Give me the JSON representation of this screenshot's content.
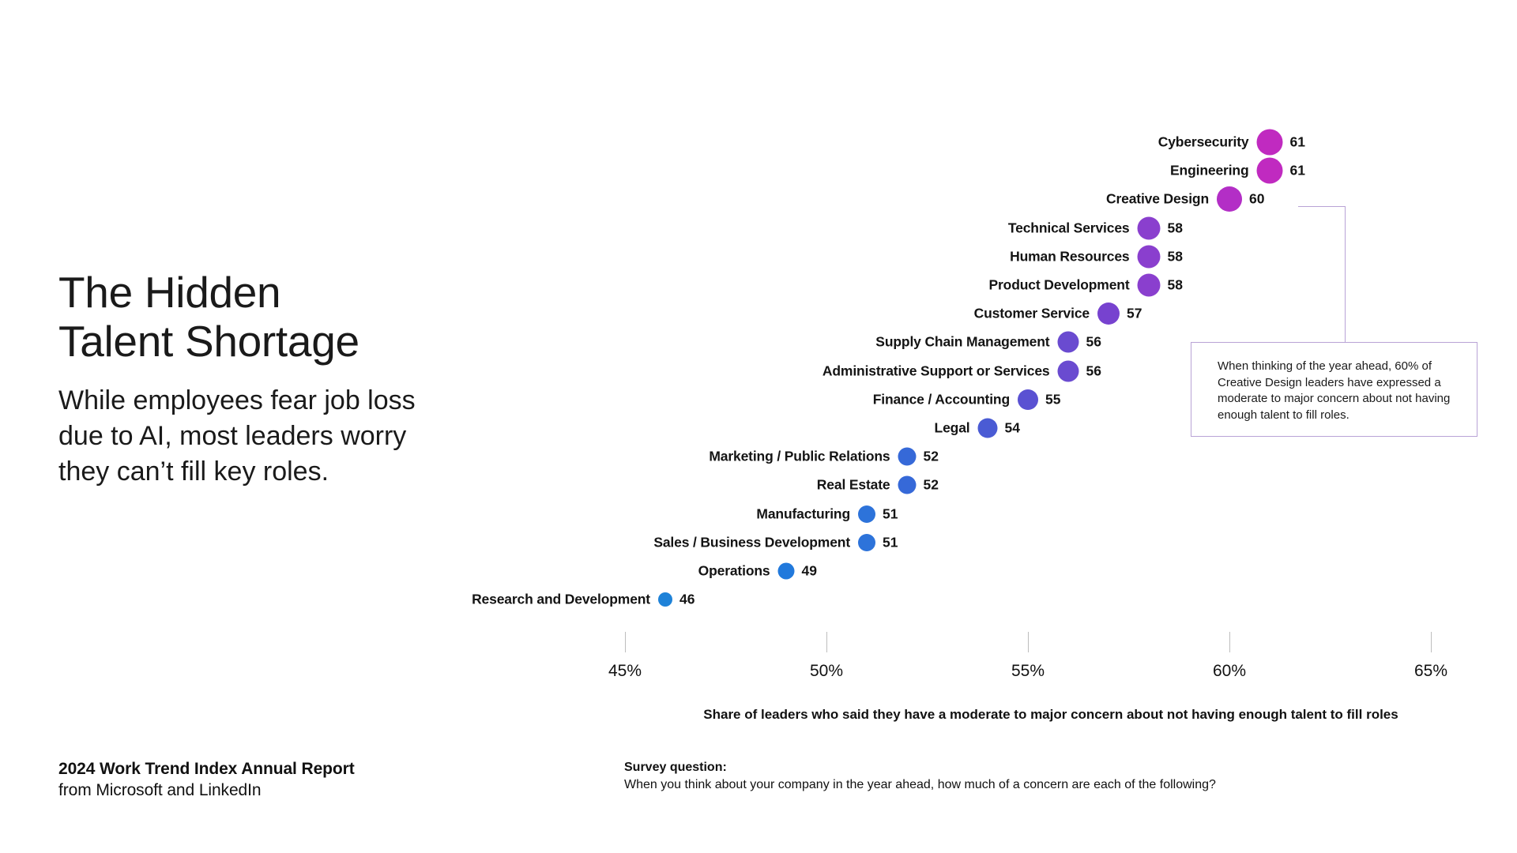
{
  "headline": "The Hidden\nTalent Shortage",
  "subhead": "While employees fear job loss\ndue to AI, most leaders worry\nthey can’t fill key roles.",
  "footer": {
    "report_title": "2024 Work Trend Index Annual Report",
    "report_source": "from Microsoft and LinkedIn",
    "survey_label": "Survey question:",
    "survey_question": "When you think about your company in the year ahead, how much of a concern are each of the following?"
  },
  "callout": {
    "text": "When thinking of the year ahead, 60% of Creative Design leaders have expressed a moderate to major concern about not having enough talent to fill roles.",
    "border_color": "#b9a3d6"
  },
  "chart_data": {
    "type": "scatter",
    "title": "The Hidden Talent Shortage",
    "xlabel": "Share of leaders who said they have a moderate to major concern about not having enough talent to fill roles",
    "ylabel": "",
    "xlim": [
      45,
      65
    ],
    "grid": false,
    "legend": "none",
    "tick_labels": [
      "45%",
      "50%",
      "55%",
      "60%",
      "65%"
    ],
    "tick_values": [
      45,
      50,
      55,
      60,
      65
    ],
    "categories": [
      "Cybersecurity",
      "Engineering",
      "Creative Design",
      "Technical Services",
      "Human Resources",
      "Product Development",
      "Customer Service",
      "Supply Chain Management",
      "Administrative Support or Services",
      "Finance / Accounting",
      "Legal",
      "Marketing / Public Relations",
      "Real Estate",
      "Manufacturing",
      "Sales / Business Development",
      "Operations",
      "Research and Development"
    ],
    "values": [
      61,
      61,
      60,
      58,
      58,
      58,
      57,
      56,
      56,
      55,
      54,
      52,
      52,
      51,
      51,
      49,
      46
    ],
    "value_labels": [
      "61",
      "61",
      "60",
      "58",
      "58",
      "58",
      "57",
      "56",
      "56",
      "55",
      "54",
      "52",
      "52",
      "51",
      "51",
      "49",
      "46"
    ],
    "colors": [
      "#c02ac0",
      "#c02ac0",
      "#b32ec6",
      "#8a3fce",
      "#8a3fce",
      "#8a3fce",
      "#7742cf",
      "#6a4bd0",
      "#6a4bd0",
      "#5a51d2",
      "#4a5bd4",
      "#3669d8",
      "#3669d8",
      "#2d73da",
      "#2d73da",
      "#2179dc",
      "#1e82d8"
    ],
    "dot_sizes": [
      33,
      33,
      32,
      29,
      29,
      29,
      28,
      27,
      27,
      26,
      25,
      23,
      23,
      22,
      22,
      21,
      18
    ]
  }
}
